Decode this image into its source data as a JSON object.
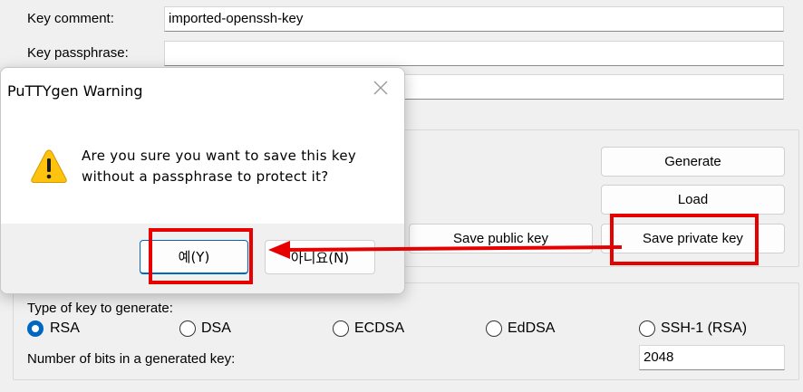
{
  "form": {
    "key_comment_label": "Key comment:",
    "key_comment_value": "imported-openssh-key",
    "key_passphrase_label": "Key passphrase:",
    "confirm_passphrase_value": "",
    "key_passphrase_value": ""
  },
  "actions": {
    "generate_label": "Generate",
    "load_label": "Load",
    "save_public_label": "Save public key",
    "save_private_label": "Save private key"
  },
  "parameters": {
    "type_label": "Type of key to generate:",
    "options": [
      "RSA",
      "DSA",
      "ECDSA",
      "EdDSA",
      "SSH-1 (RSA)"
    ],
    "selected": "RSA",
    "bits_label": "Number of bits in a generated key:",
    "bits_value": "2048"
  },
  "dialog": {
    "title": "PuTTYgen Warning",
    "message_line1": "Are you sure you want to save this key",
    "message_line2": "without a passphrase to protect it?",
    "yes_label": "예(Y)",
    "no_label": "아니요(N)",
    "close_icon": "close-icon",
    "warning_icon": "warning-triangle-icon"
  },
  "annotation": {
    "highlight_color": "#e60000"
  }
}
